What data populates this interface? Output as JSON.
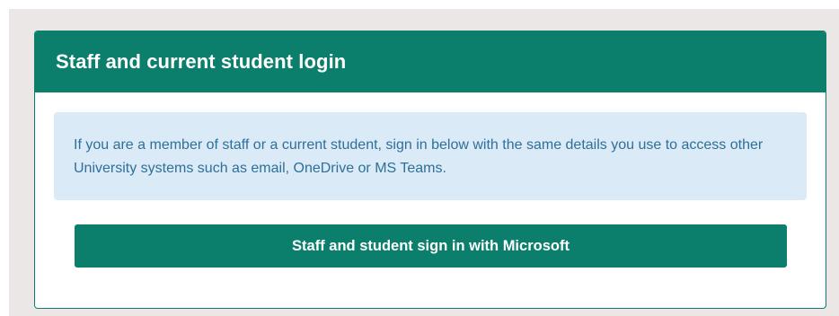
{
  "login": {
    "title": "Staff and current student login",
    "info_text": "If you are a member of staff or a current student, sign in below with the same details you use to access other University systems such as email, OneDrive or MS Teams.",
    "signin_button_label": "Staff and student sign in with Microsoft"
  },
  "colors": {
    "brand_green": "#0b7f6b",
    "info_background": "#daeaf6",
    "info_text": "#2f6f99",
    "page_background": "#ebe7e7"
  }
}
